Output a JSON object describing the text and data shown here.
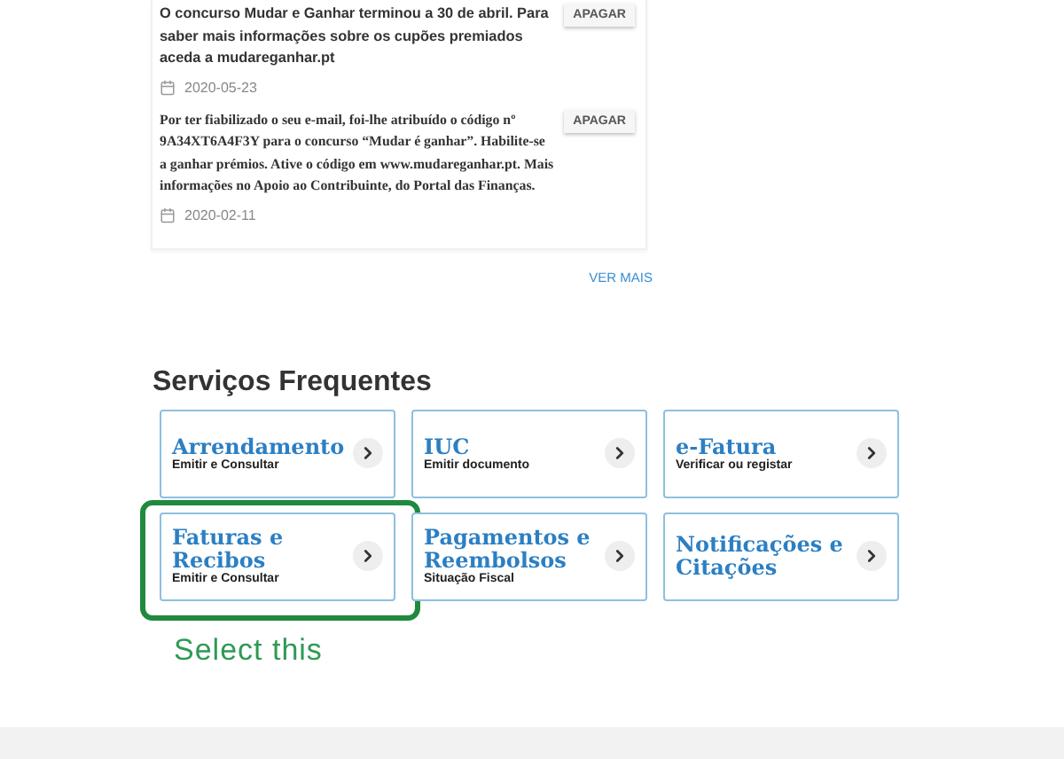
{
  "messages": [
    {
      "text": "O concurso Mudar e Ganhar terminou a 30 de abril. Para saber mais informações sobre os cupões premiados aceda a mudareganhar.pt",
      "serif": false,
      "date": "2020-05-23",
      "action": "APAGAR"
    },
    {
      "text": "Por ter fiabilizado o seu e-mail, foi-lhe atribuído o código nº 9A34XT6A4F3Y  para o concurso “Mudar é ganhar”. Habilite-se a ganhar prémios. Ative o código em www.mudareganhar.pt. Mais informações no Apoio ao Contribuinte, do Portal das Finanças.",
      "serif": true,
      "date": "2020-02-11",
      "action": "APAGAR"
    }
  ],
  "more_link": "VER MAIS",
  "services": {
    "title": "Serviços Frequentes",
    "items": [
      {
        "title": "Arrendamento",
        "subtitle": "Emitir e Consultar",
        "highlighted": false
      },
      {
        "title": "IUC",
        "subtitle": "Emitir documento",
        "highlighted": false
      },
      {
        "title": "e-Fatura",
        "subtitle": "Verificar ou registar",
        "highlighted": false
      },
      {
        "title": "Faturas e Recibos",
        "subtitle": "Emitir e Consultar",
        "highlighted": true
      },
      {
        "title": "Pagamentos e Reembolsos",
        "subtitle": "Situação Fiscal",
        "highlighted": false
      },
      {
        "title": "Notificações e Citações",
        "highlighted": false
      }
    ]
  },
  "annotation": "Select this"
}
